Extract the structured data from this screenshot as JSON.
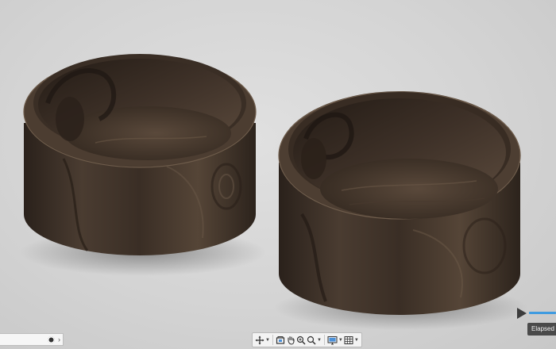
{
  "viewport": {
    "background": "#d4d4d4",
    "objects": [
      "wooden-bowl-left",
      "wooden-bowl-right"
    ],
    "wood_color": "#3b2f26"
  },
  "navigation_toolbar": {
    "tools": [
      "orbit",
      "pan",
      "look-at",
      "zoom",
      "fit",
      "display-settings",
      "grid-settings"
    ]
  },
  "playback": {
    "tooltip": "Elapsed ti",
    "accent": "#3f9be0"
  }
}
